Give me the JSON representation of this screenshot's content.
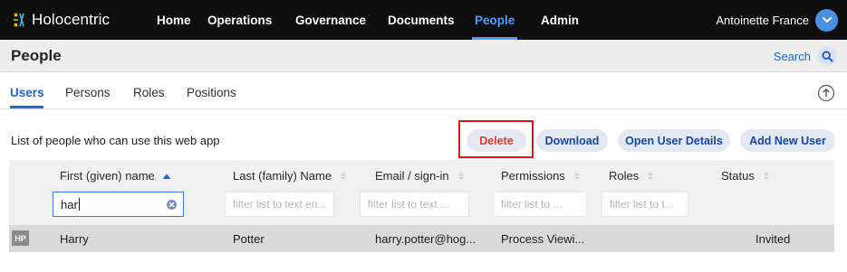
{
  "app": {
    "brand_name": "Holocentric",
    "nav": [
      "Home",
      "Operations",
      "Governance",
      "Documents",
      "People",
      "Admin"
    ],
    "active_nav": "People",
    "user_name": "Antoinette France"
  },
  "page": {
    "title": "People",
    "search_label": "Search"
  },
  "tabs": [
    "Users",
    "Persons",
    "Roles",
    "Positions"
  ],
  "active_tab": "Users",
  "toolbar": {
    "description": "List of people who can use this web app",
    "delete_label": "Delete",
    "download_label": "Download",
    "open_details_label": "Open User Details",
    "add_new_label": "Add New User"
  },
  "table": {
    "columns": [
      {
        "title": "First (given) name",
        "filter_value": "har",
        "filter_placeholder": ""
      },
      {
        "title": "Last (family) Name",
        "filter_value": "",
        "filter_placeholder": "filter list to text en..."
      },
      {
        "title": "Email / sign-in",
        "filter_value": "",
        "filter_placeholder": "filter list to text ..."
      },
      {
        "title": "Permissions",
        "filter_value": "",
        "filter_placeholder": "filter list to ..."
      },
      {
        "title": "Roles",
        "filter_value": "",
        "filter_placeholder": "filter list to t..."
      },
      {
        "title": "Status",
        "filter_value": "",
        "filter_placeholder": ""
      }
    ],
    "sorted_column": "First (given) name",
    "sort_direction": "ascending",
    "rows": [
      {
        "initials": "HP",
        "first": "Harry",
        "last": "Potter",
        "email": "harry.potter@hog...",
        "permissions": "Process Viewi...",
        "roles": "",
        "status": "Invited"
      }
    ]
  },
  "colors": {
    "accent": "#1f63d6",
    "nav_active": "#4f9dff",
    "delete_text": "#e23a2e",
    "highlight_box": "#e01717",
    "topbar": "#0e0e0e"
  }
}
